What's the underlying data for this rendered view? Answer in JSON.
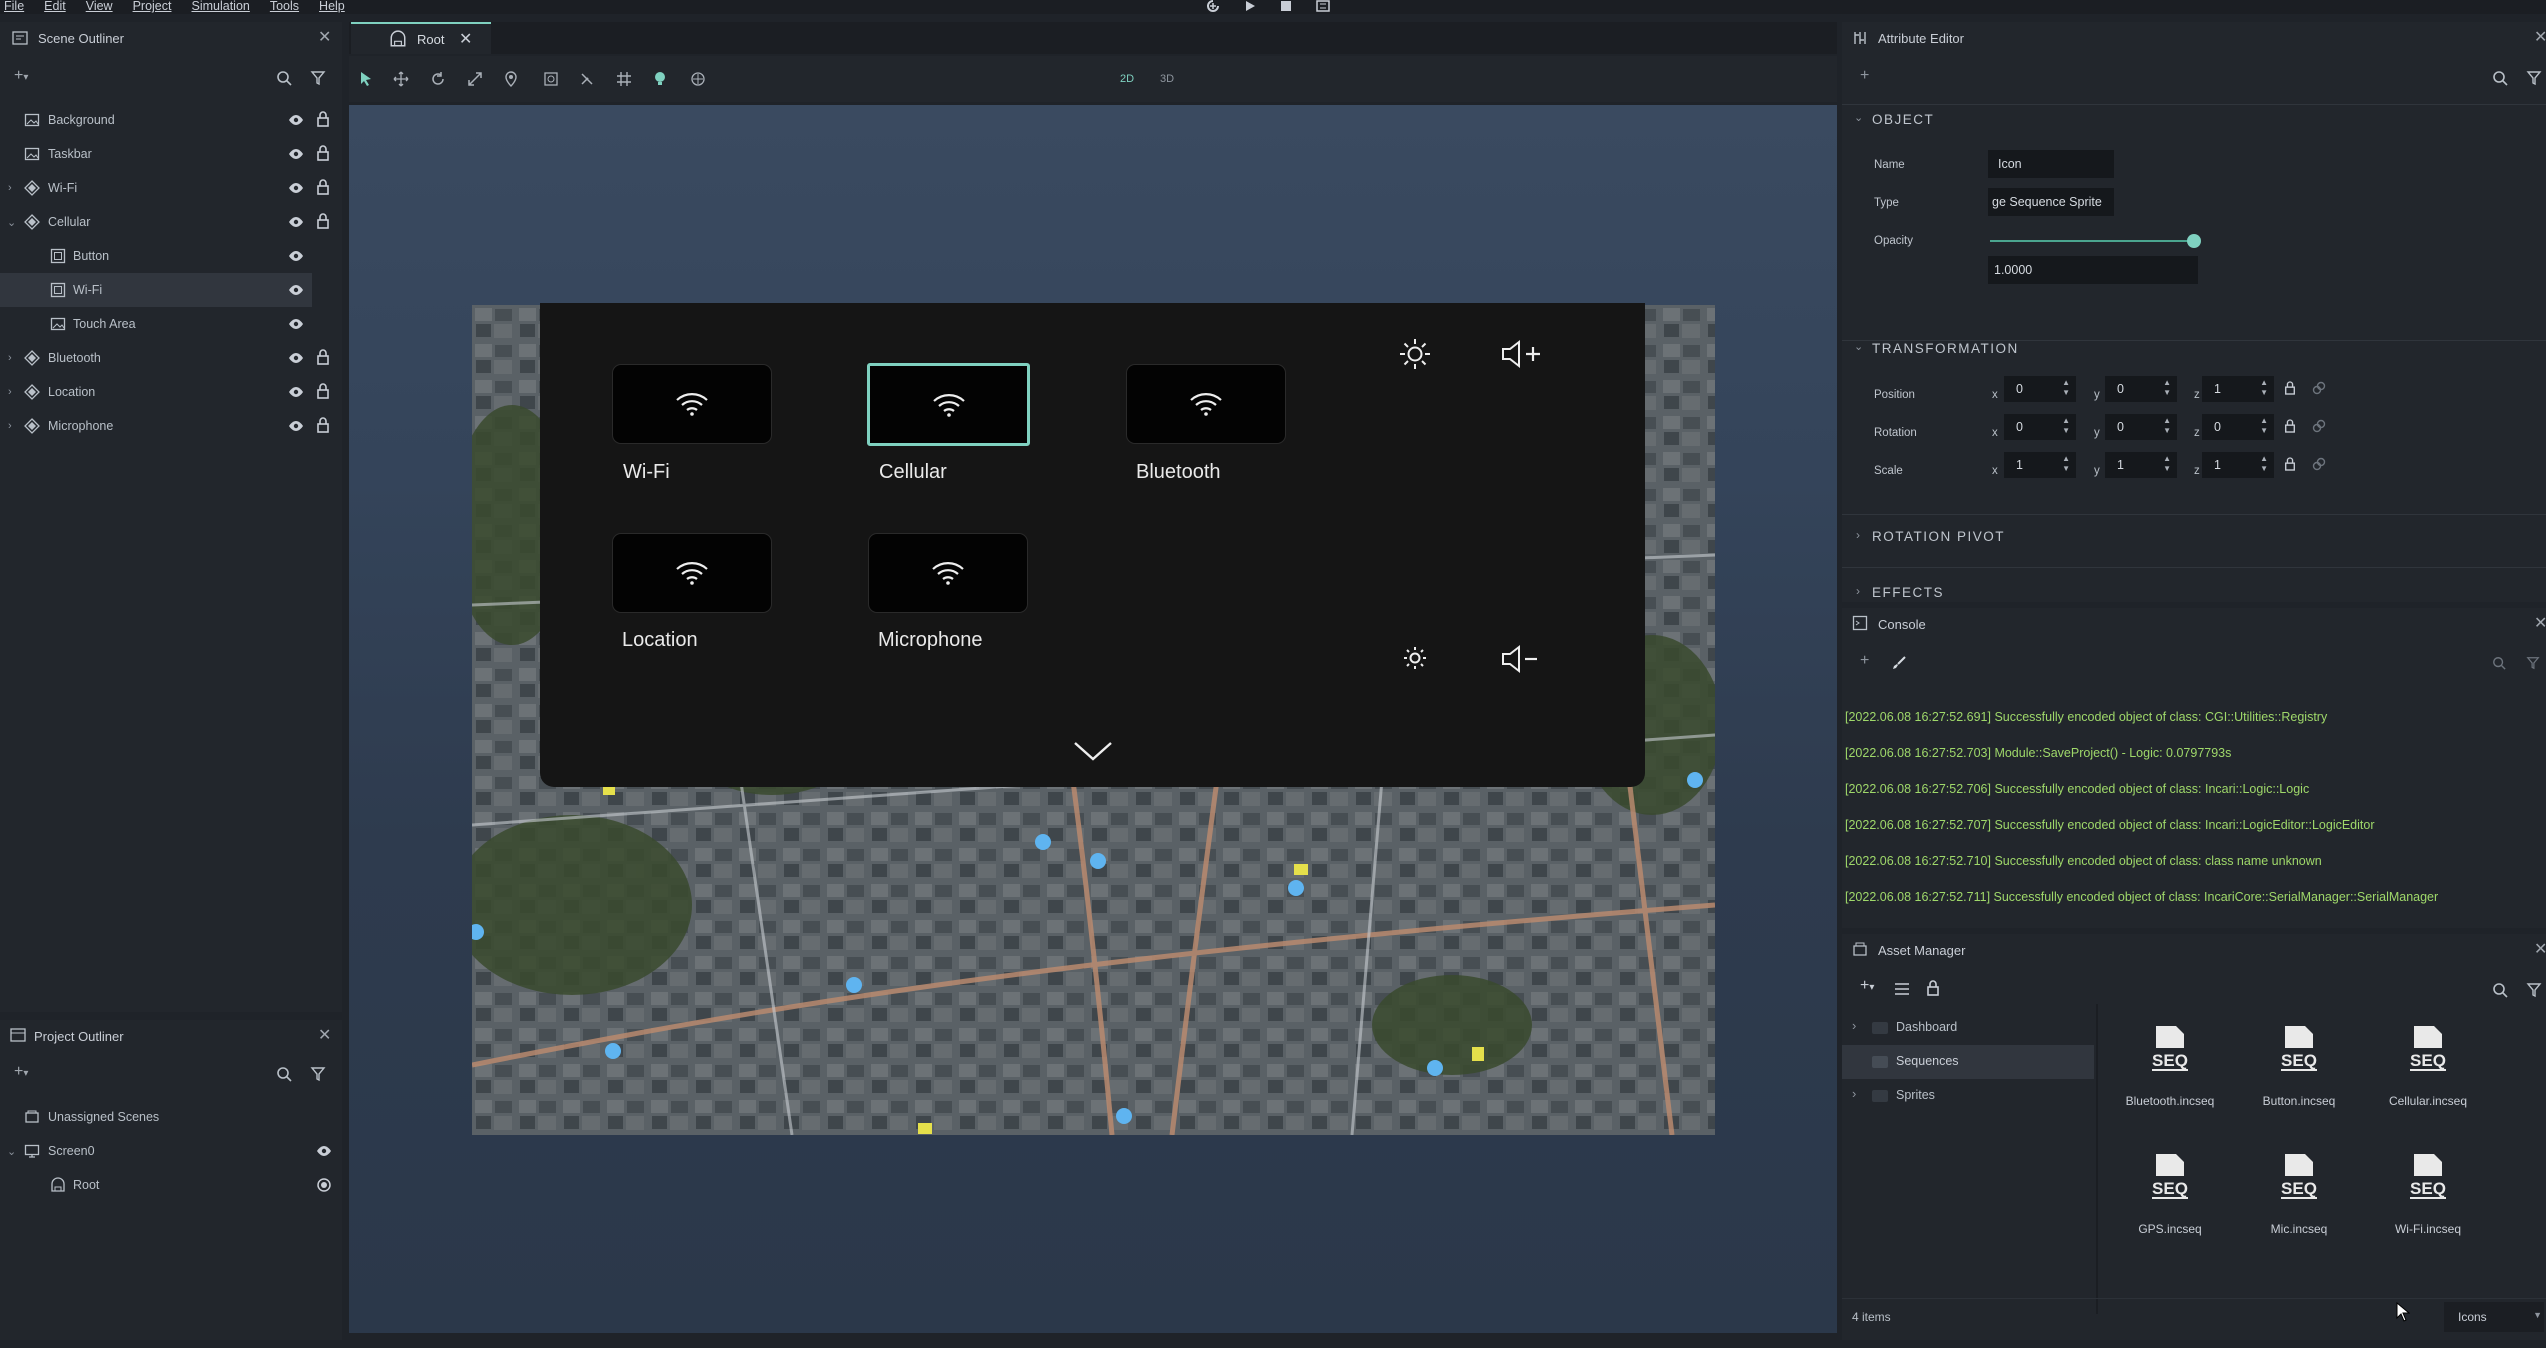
{
  "menubar": {
    "items": [
      "File",
      "Edit",
      "View",
      "Project",
      "Simulation",
      "Tools",
      "Help"
    ]
  },
  "scene_outliner": {
    "title": "Scene Outliner",
    "items": [
      {
        "label": "Background"
      },
      {
        "label": "Taskbar"
      },
      {
        "label": "Wi-Fi"
      },
      {
        "label": "Cellular"
      },
      {
        "label": "Button"
      },
      {
        "label": "Wi-Fi"
      },
      {
        "label": "Touch Area"
      },
      {
        "label": "Bluetooth"
      },
      {
        "label": "Location"
      },
      {
        "label": "Microphone"
      }
    ]
  },
  "project_outliner": {
    "title": "Project Outliner",
    "items": [
      {
        "label": "Unassigned Scenes"
      },
      {
        "label": "Screen0"
      },
      {
        "label": "Root"
      }
    ]
  },
  "editor_tab": {
    "label": "Root"
  },
  "toolbar": {
    "mode_2d": "2D",
    "mode_3d": "3D"
  },
  "control_center": {
    "tiles": [
      {
        "label": "Wi-Fi"
      },
      {
        "label": "Cellular"
      },
      {
        "label": "Bluetooth"
      },
      {
        "label": "Location"
      },
      {
        "label": "Microphone"
      }
    ]
  },
  "attribute_editor": {
    "title": "Attribute Editor",
    "object_section": "OBJECT",
    "name_label": "Name",
    "name_value": "Icon",
    "type_label": "Type",
    "type_value": "ge Sequence Sprite",
    "opacity_label": "Opacity",
    "opacity_value": "1.0000",
    "opacity": 1.0,
    "transformation_section": "TRANSFORMATION",
    "position_label": "Position",
    "rotation_label": "Rotation",
    "scale_label": "Scale",
    "axis_x": "x",
    "axis_y": "y",
    "axis_z": "z",
    "position": {
      "x": "0",
      "y": "0",
      "z": "1"
    },
    "rotation": {
      "x": "0",
      "y": "0",
      "z": "0"
    },
    "scale": {
      "x": "1",
      "y": "1",
      "z": "1"
    },
    "rotation_pivot_section": "ROTATION PIVOT",
    "effects_section": "EFFECTS"
  },
  "console": {
    "title": "Console",
    "lines": [
      "[2022.06.08 16:27:52.691] Successfully encoded object of class: CGI::Utilities::Registry",
      "[2022.06.08 16:27:52.703] Module::SaveProject() - Logic: 0.0797793s",
      "[2022.06.08 16:27:52.706] Successfully encoded object of class: Incari::Logic::Logic",
      "[2022.06.08 16:27:52.707] Successfully encoded object of class: Incari::LogicEditor::LogicEditor",
      "[2022.06.08 16:27:52.710] Successfully encoded object of class: class name unknown",
      "[2022.06.08 16:27:52.711] Successfully encoded object of class: IncariCore::SerialManager::SerialManager"
    ]
  },
  "asset_manager": {
    "title": "Asset Manager",
    "tree": [
      {
        "label": "Dashboard"
      },
      {
        "label": "Sequences"
      },
      {
        "label": "Sprites"
      }
    ],
    "seq_badge": "SEQ",
    "assets": [
      {
        "label": "Bluetooth.incseq"
      },
      {
        "label": "Button.incseq"
      },
      {
        "label": "Cellular.incseq"
      },
      {
        "label": "GPS.incseq"
      },
      {
        "label": "Mic.incseq"
      },
      {
        "label": "Wi-Fi.incseq"
      }
    ],
    "count": "4 items",
    "view_mode": "Icons"
  },
  "colors": {
    "accent": "#7fd1c0",
    "console_text": "#9fd86a",
    "background": "#1f2329",
    "panel": "#22262c"
  }
}
